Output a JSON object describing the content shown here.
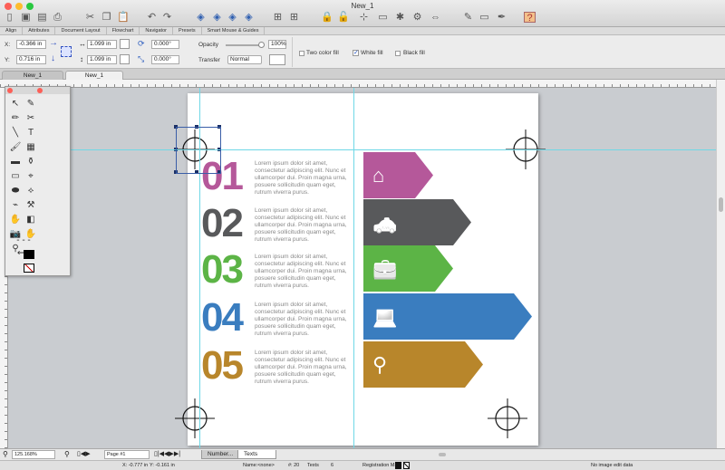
{
  "window": {
    "title": "New_1"
  },
  "toolbar": {
    "icons": [
      "new-document",
      "open",
      "save",
      "print",
      "cut",
      "copy",
      "paste",
      "undo",
      "redo",
      "bring-front",
      "bring-forward",
      "send-backward",
      "send-back",
      "group",
      "ungroup",
      "lock",
      "unlock",
      "toggle-guides",
      "window",
      "stamp",
      "settings",
      "fit",
      "edit",
      "monitor",
      "pen",
      "help"
    ]
  },
  "panel_tabs": [
    "Align",
    "Attributes",
    "Document Layout",
    "Flowchart",
    "Navigator",
    "Presets",
    "Smart Mouse & Guides"
  ],
  "inspector": {
    "x_label": "X:",
    "x_value": "-0.366 in",
    "y_label": "Y:",
    "y_value": "0.716 in",
    "w_value": "1.099 in",
    "h_value": "1.099 in",
    "rot1": "0.000°",
    "rot2": "0.000°",
    "opacity_label": "Opacity",
    "opacity_value": "100%",
    "opacity": 1.0,
    "transfer_label": "Transfer",
    "transfer_value": "Normal",
    "two_color_fill": "Two color fill",
    "white_fill": "White fill",
    "black_fill": "Black fill",
    "two_color_checked": false,
    "white_checked": true,
    "black_checked": false
  },
  "doc_tabs": [
    "New_1",
    "New_1"
  ],
  "infographic": {
    "lorem": "Lorem ipsum dolor sit amet, consectetur adipiscing elit. Nunc et ullamcorper dui. Proin magna urna, posuere sollicitudin quam eget, rutrum viverra purus.",
    "items": [
      {
        "num": "01",
        "color": "#b5589a",
        "icon": "home-icon"
      },
      {
        "num": "02",
        "color": "#58595b",
        "icon": "taxi-icon"
      },
      {
        "num": "03",
        "color": "#5cb446",
        "icon": "suitcase-icon"
      },
      {
        "num": "04",
        "color": "#3a7dbf",
        "icon": "laptop-icon"
      },
      {
        "num": "05",
        "color": "#b8862b",
        "icon": "map-pin-icon"
      }
    ]
  },
  "bottom": {
    "zoom": "125.168%",
    "page": "Page #1",
    "tabs": [
      "Number...",
      "Texts"
    ]
  },
  "status": {
    "x": "X: -0.777 in",
    "y": "Y: -0.161 in",
    "name": "Name:<none>",
    "count": "#: 20",
    "texts": "Texts",
    "layers": "6",
    "registration": "Registration Mark",
    "image": "No image edit data"
  }
}
